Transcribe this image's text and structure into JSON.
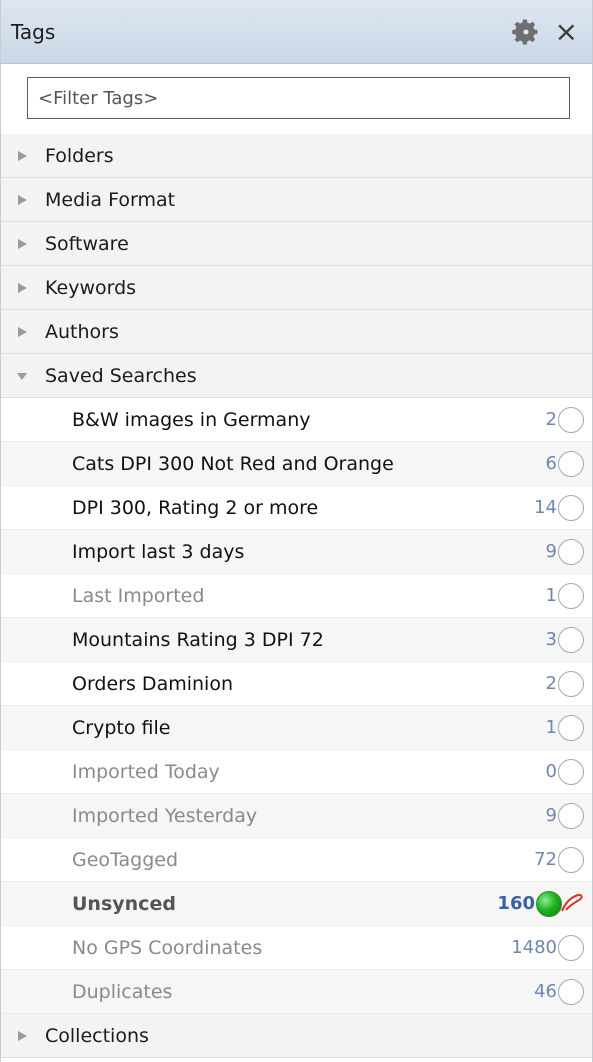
{
  "header": {
    "title": "Tags",
    "settings_icon": "gear-icon",
    "close_label": "×"
  },
  "filter": {
    "placeholder": "<Filter Tags>"
  },
  "groups_top": [
    {
      "label": "Folders",
      "expanded": false
    },
    {
      "label": "Media Format",
      "expanded": false
    },
    {
      "label": "Software",
      "expanded": false
    },
    {
      "label": "Keywords",
      "expanded": false
    },
    {
      "label": "Authors",
      "expanded": false
    }
  ],
  "saved_searches": {
    "label": "Saved Searches",
    "expanded": true,
    "items": [
      {
        "label": "B&W images in Germany",
        "count": "2",
        "dim": false,
        "active": false
      },
      {
        "label": "Cats DPI 300 Not Red and Orange",
        "count": "6",
        "dim": false,
        "active": false
      },
      {
        "label": "DPI 300, Rating 2 or more",
        "count": "14",
        "dim": false,
        "active": false
      },
      {
        "label": "Import last 3 days",
        "count": "9",
        "dim": false,
        "active": false
      },
      {
        "label": "Last Imported",
        "count": "1",
        "dim": true,
        "active": false
      },
      {
        "label": "Mountains Rating 3 DPI 72",
        "count": "3",
        "dim": false,
        "active": false
      },
      {
        "label": "Orders Daminion",
        "count": "2",
        "dim": false,
        "active": false
      },
      {
        "label": "Crypto file",
        "count": "1",
        "dim": false,
        "active": false
      },
      {
        "label": "Imported Today",
        "count": "0",
        "dim": true,
        "active": false
      },
      {
        "label": "Imported Yesterday",
        "count": "9",
        "dim": true,
        "active": false
      },
      {
        "label": "GeoTagged",
        "count": "72",
        "dim": true,
        "active": false
      },
      {
        "label": "Unsynced",
        "count": "160",
        "dim": false,
        "bold": true,
        "active": true
      },
      {
        "label": "No GPS Coordinates",
        "count": "1480",
        "dim": true,
        "active": false
      },
      {
        "label": "Duplicates",
        "count": "46",
        "dim": true,
        "active": false
      }
    ]
  },
  "groups_bottom": [
    {
      "label": "Collections",
      "expanded": false
    }
  ],
  "colors": {
    "header_bg": "#cbd7e6",
    "count_text": "#6f86b0",
    "active_dot": "#21b221",
    "pin": "#d9342b"
  }
}
